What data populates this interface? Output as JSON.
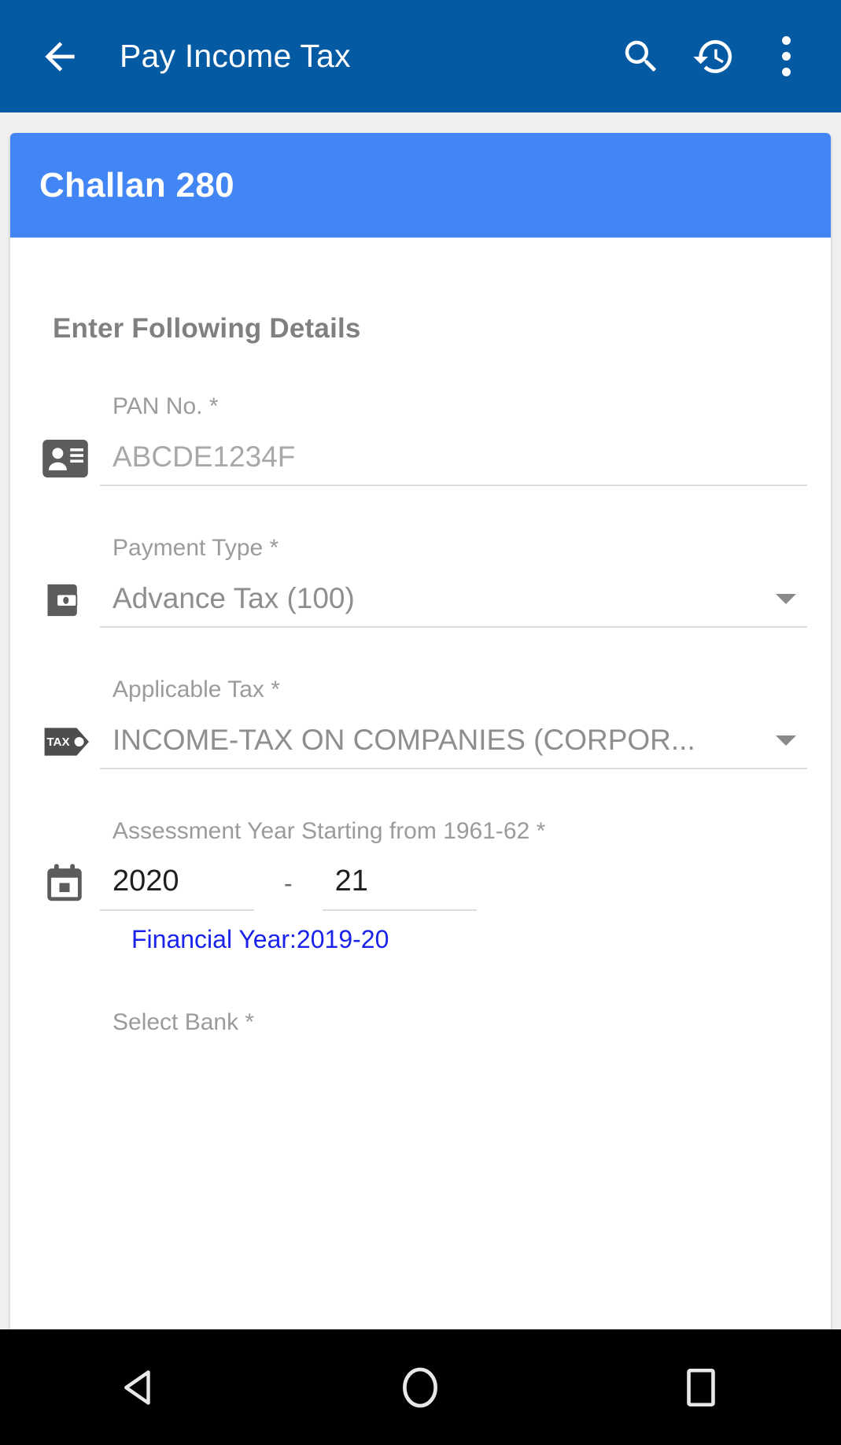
{
  "appbar": {
    "title": "Pay Income Tax",
    "back_icon": "arrow-back-icon",
    "search_icon": "search-icon",
    "history_icon": "history-icon",
    "overflow_icon": "more-vert-icon",
    "background": "#055BA3"
  },
  "card": {
    "header_title": "Challan 280",
    "header_background": "#4285F4",
    "section_title": "Enter Following Details"
  },
  "form": {
    "pan": {
      "label": "PAN No. *",
      "placeholder": "ABCDE1234F",
      "value": "",
      "icon": "contact-card-icon"
    },
    "payment_type": {
      "label": "Payment Type *",
      "value": "Advance Tax (100)",
      "icon": "wallet-icon"
    },
    "applicable_tax": {
      "label": "Applicable Tax *",
      "value": "INCOME-TAX ON COMPANIES (CORPOR...",
      "icon": "tax-tag-icon"
    },
    "assessment_year": {
      "label": "Assessment Year Starting from 1961-62 *",
      "icon": "calendar-icon",
      "year_start": "2020",
      "separator": "-",
      "year_end": "21",
      "financial_year": "Financial Year:2019-20",
      "financial_year_color": "#1a23ea"
    },
    "select_bank": {
      "label": "Select Bank *"
    }
  },
  "navbar": {
    "back_icon": "nav-back-triangle-icon",
    "home_icon": "nav-home-circle-icon",
    "recents_icon": "nav-recents-square-icon"
  }
}
